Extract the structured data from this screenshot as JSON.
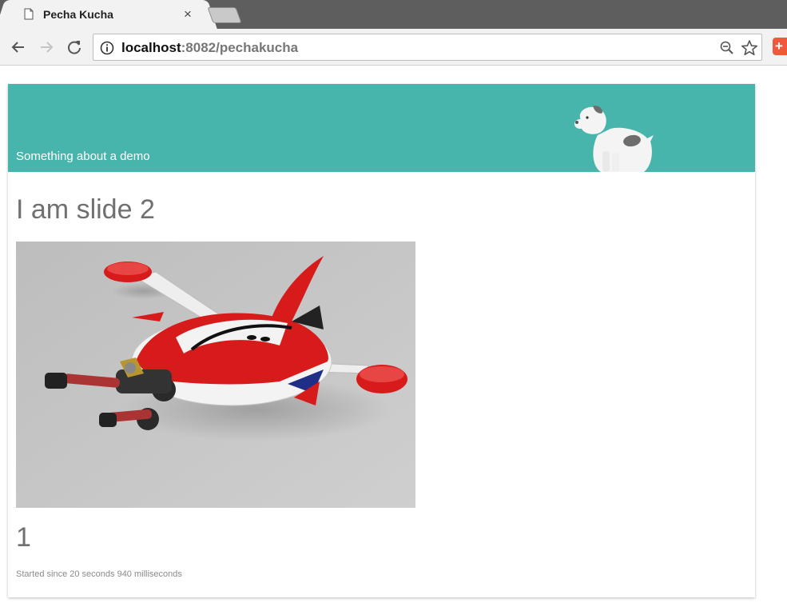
{
  "browser": {
    "tab_title": "Pecha Kucha",
    "tab_close": "×",
    "url_host": "localhost",
    "url_path": ":8082/pechakucha",
    "extension_label": "+"
  },
  "page": {
    "banner_title": "Something about a demo",
    "slide_title": "I am slide 2",
    "slide_number": "1",
    "status_text": "Started since 20 seconds 940 milliseconds"
  },
  "colors": {
    "banner": "#48b5ac",
    "heading": "#707070",
    "accent_red": "#d71a1a"
  }
}
